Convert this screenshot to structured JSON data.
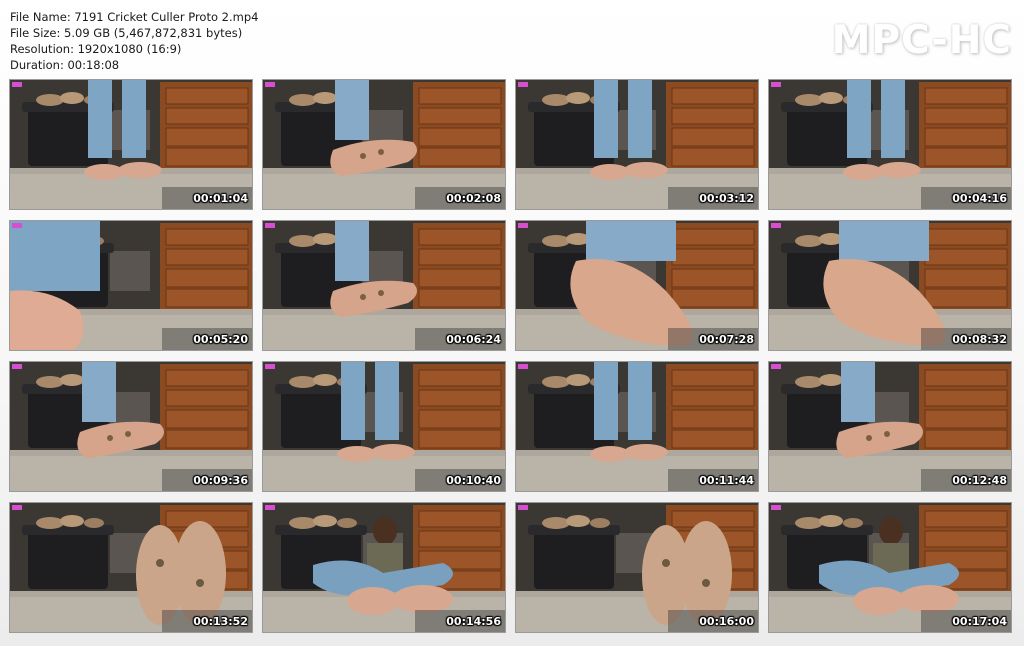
{
  "file_info": {
    "file_name": "File Name: 7191 Cricket Culler Proto 2.mp4",
    "file_size": "File Size: 5.09 GB (5,467,872,831 bytes)",
    "resolution": "Resolution: 1920x1080 (16:9)",
    "duration": "Duration: 00:18:08"
  },
  "logo": "MPC-HC",
  "thumbnails": [
    {
      "timestamp": "00:01:04",
      "scene": "standing-feet"
    },
    {
      "timestamp": "00:02:08",
      "scene": "foot-raised"
    },
    {
      "timestamp": "00:03:12",
      "scene": "standing-feet"
    },
    {
      "timestamp": "00:04:16",
      "scene": "standing-feet"
    },
    {
      "timestamp": "00:05:20",
      "scene": "closeup-toes"
    },
    {
      "timestamp": "00:06:24",
      "scene": "foot-raised"
    },
    {
      "timestamp": "00:07:28",
      "scene": "closeup-sole"
    },
    {
      "timestamp": "00:08:32",
      "scene": "closeup-sole"
    },
    {
      "timestamp": "00:09:36",
      "scene": "foot-raised"
    },
    {
      "timestamp": "00:10:40",
      "scene": "standing-feet"
    },
    {
      "timestamp": "00:11:44",
      "scene": "standing-feet"
    },
    {
      "timestamp": "00:12:48",
      "scene": "foot-raised"
    },
    {
      "timestamp": "00:13:52",
      "scene": "soles-up"
    },
    {
      "timestamp": "00:14:56",
      "scene": "sitting"
    },
    {
      "timestamp": "00:16:00",
      "scene": "soles-up"
    },
    {
      "timestamp": "00:17:04",
      "scene": "sitting"
    }
  ]
}
